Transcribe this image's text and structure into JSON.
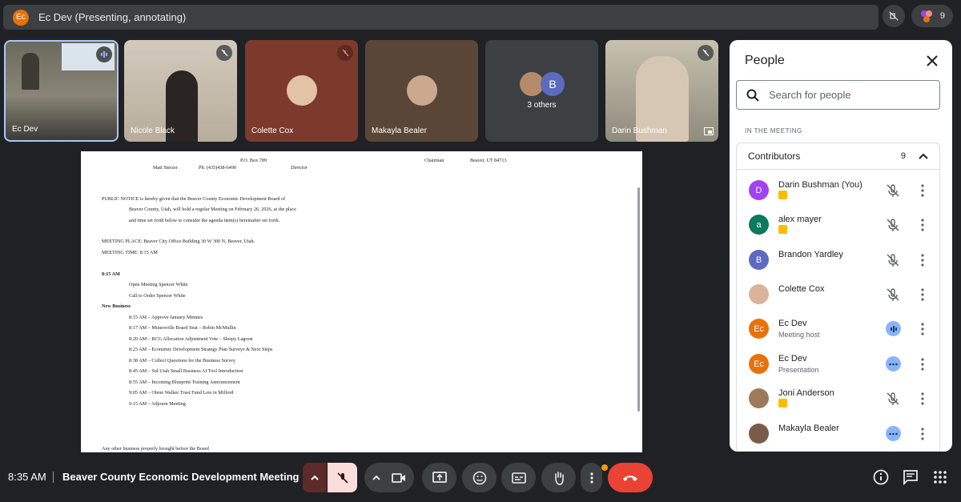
{
  "topbar": {
    "badge": "Ec",
    "title": "Ec Dev (Presenting, annotating)",
    "participants_count": "9"
  },
  "tiles": [
    {
      "name": "Ec Dev"
    },
    {
      "name": "Nicole Black"
    },
    {
      "name": "Colette Cox"
    },
    {
      "name": "Makayla Bealer"
    },
    {
      "name": "3 others",
      "avatar_letter": "B"
    },
    {
      "name": "Darin Bushman"
    }
  ],
  "slide": {
    "lines": [
      {
        "text": "P.O. Box 789",
        "cls": ""
      },
      {
        "text": "Chairman",
        "cls": ""
      },
      {
        "text": "Beaver, UT 84713",
        "cls": ""
      },
      {
        "text": "Matt Sterzer",
        "cls": ""
      },
      {
        "text": "Ph: (435)438-6490",
        "cls": ""
      },
      {
        "text": "Director",
        "cls": ""
      },
      {
        "text": "PUBLIC NOTICE is hereby given that the Beaver County Economic Development Board of",
        "cls": ""
      },
      {
        "text": "Beaver County, Utah, will hold a regular Meeting on February 26, 2026, at the place",
        "cls": ""
      },
      {
        "text": "and time set forth below to consider the agenda item(s) hereinafter set forth.",
        "cls": ""
      },
      {
        "text": "MEETING PLACE: Beaver City Office Building 30 W 300 N, Beaver, Utah.",
        "cls": ""
      },
      {
        "text": "MEETING TIME: 8:15 AM",
        "cls": ""
      },
      {
        "text": "8:15 AM",
        "cls": "bold"
      },
      {
        "text": "Open Meeting Spencer White",
        "cls": ""
      },
      {
        "text": "Call to Order Spencer White",
        "cls": ""
      },
      {
        "text": "New Business",
        "cls": "bold"
      },
      {
        "text": "8:15 AM – Approve January Minutes",
        "cls": ""
      },
      {
        "text": "8:17 AM – Minersville Board Seat – Robin McMullin",
        "cls": ""
      },
      {
        "text": "8:20 AM – RCG Allocation Adjustment Vote – Sleepy Lagoon",
        "cls": ""
      },
      {
        "text": "8:23 AM – Economic Development Strategy Plan Surveys & Next Steps",
        "cls": ""
      },
      {
        "text": "8:38 AM – Collect Questions for the Business Survey",
        "cls": ""
      },
      {
        "text": "8:45 AM – Sul Utah Small Business AI Tool Introduction",
        "cls": ""
      },
      {
        "text": "8:55 AM – Incoming Blueprint Training Announcement",
        "cls": ""
      },
      {
        "text": "9:05 AM – Olene Walker Trust Fund Lots in Milford",
        "cls": ""
      },
      {
        "text": "9:15 AM – Adjourn Meeting",
        "cls": ""
      },
      {
        "text": "Any other business properly brought before the Board",
        "cls": ""
      }
    ]
  },
  "panel": {
    "title": "People",
    "search_placeholder": "Search for people",
    "section_label": "IN THE MEETING",
    "group_label": "Contributors",
    "group_count": "9",
    "people": [
      {
        "name": "Darin Bushman (You)",
        "sub": "",
        "letter": "D",
        "color": "#a142f4",
        "tag": true,
        "state": "muted"
      },
      {
        "name": "alex mayer",
        "sub": "",
        "letter": "a",
        "color": "#0b7a5f",
        "tag": true,
        "state": "muted"
      },
      {
        "name": "Brandon Yardley",
        "sub": "",
        "letter": "B",
        "color": "#5c6bc0",
        "tag": false,
        "state": "muted"
      },
      {
        "name": "Colette Cox",
        "sub": "",
        "letter": "",
        "color": "#d9b49a",
        "tag": false,
        "state": "muted"
      },
      {
        "name": "Ec Dev",
        "sub": "Meeting host",
        "letter": "Ec",
        "color": "#e8710a",
        "tag": false,
        "state": "speaking"
      },
      {
        "name": "Ec Dev",
        "sub": "Presentation",
        "letter": "Ec",
        "color": "#e8710a",
        "tag": false,
        "state": "idle"
      },
      {
        "name": "Joni Anderson",
        "sub": "",
        "letter": "",
        "color": "#9c7a5b",
        "tag": true,
        "state": "muted"
      },
      {
        "name": "Makayla Bealer",
        "sub": "",
        "letter": "",
        "color": "#7a5a48",
        "tag": false,
        "state": "idle"
      }
    ]
  },
  "bottom": {
    "time": "8:35 AM",
    "meeting_name": "Beaver County Economic Development Meeting"
  }
}
